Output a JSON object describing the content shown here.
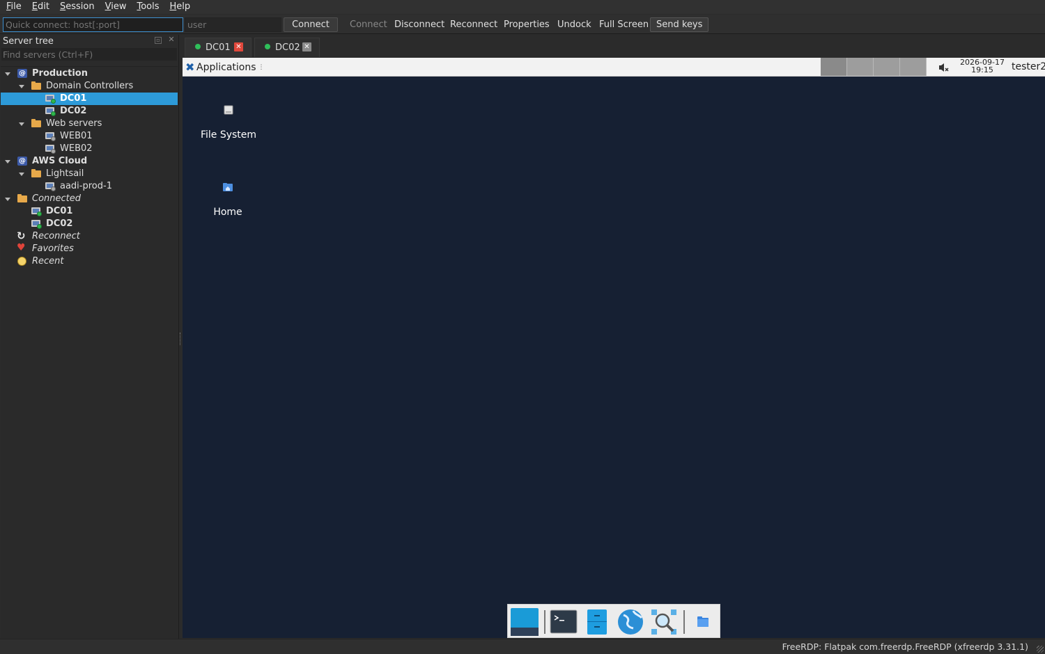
{
  "menubar": {
    "items": [
      {
        "label": "File",
        "ul": "F",
        "rest": "ile"
      },
      {
        "label": "Edit",
        "ul": "E",
        "rest": "dit"
      },
      {
        "label": "Session",
        "ul": "S",
        "rest": "ession"
      },
      {
        "label": "View",
        "ul": "V",
        "rest": "iew"
      },
      {
        "label": "Tools",
        "ul": "T",
        "rest": "ools"
      },
      {
        "label": "Help",
        "ul": "H",
        "rest": "elp"
      }
    ]
  },
  "toolbar": {
    "quick_connect_placeholder": "Quick connect: host[:port]",
    "user_placeholder": "user",
    "connect_button": "Connect",
    "actions": {
      "connect": "Connect",
      "disconnect": "Disconnect",
      "reconnect": "Reconnect",
      "properties": "Properties",
      "undock": "Undock",
      "full_screen": "Full Screen",
      "send_keys": "Send keys"
    }
  },
  "sidebar": {
    "title": "Server tree",
    "find_placeholder": "Find servers (Ctrl+F)",
    "tree": {
      "production": "Production",
      "domain_controllers": "Domain Controllers",
      "dc01": "DC01",
      "dc02": "DC02",
      "web_servers": "Web servers",
      "web01": "WEB01",
      "web02": "WEB02",
      "aws_cloud": "AWS Cloud",
      "lightsail": "Lightsail",
      "aadi": "aadi-prod-1",
      "connected": "Connected",
      "connected_dc01": "DC01",
      "connected_dc02": "DC02",
      "reconnect": "Reconnect",
      "favorites": "Favorites",
      "recent": "Recent"
    }
  },
  "tabs": [
    {
      "label": "DC01",
      "active": true
    },
    {
      "label": "DC02",
      "active": false
    }
  ],
  "remote": {
    "panel": {
      "applications": "Applications",
      "date": "2026-09-17",
      "time": "19:15",
      "user": "tester2"
    },
    "desktop_icons": {
      "file_system": "File System",
      "home": "Home"
    }
  },
  "statusbar": {
    "text": "FreeRDP: Flatpak com.freerdp.FreeRDP (xfreerdp 3.31.1)"
  },
  "colors": {
    "selection": "#2d9ad8",
    "desktop_bg": "#162033",
    "status_green": "#2eb74d"
  }
}
